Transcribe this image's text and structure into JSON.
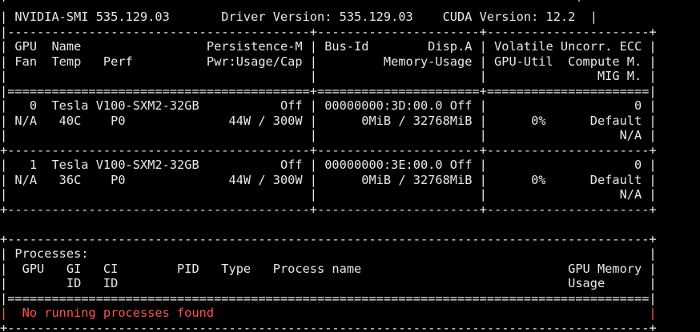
{
  "theme": {
    "background": "#000000",
    "foreground": "#e8e8e8",
    "error_text": "#ff5151"
  },
  "terminal": {
    "lines": [
      "+-----------------------------------------------------------------------------+",
      "| NVIDIA-SMI 535.129.03       Driver Version: 535.129.03    CUDA Version: 12.2  |",
      "|-----------------------------------------+----------------------+----------------------+",
      "| GPU  Name                 Persistence-M | Bus-Id        Disp.A | Volatile Uncorr. ECC |",
      "| Fan  Temp   Perf          Pwr:Usage/Cap |         Memory-Usage | GPU-Util  Compute M. |",
      "|                                         |                      |               MIG M. |",
      "|=========================================+======================+======================|",
      "|   0  Tesla V100-SXM2-32GB           Off | 00000000:3D:00.0 Off |                    0 |",
      "| N/A   40C    P0              44W / 300W |      0MiB / 32768MiB |      0%      Default |",
      "|                                         |                      |                  N/A |",
      "+-----------------------------------------+----------------------+----------------------+",
      "|   1  Tesla V100-SXM2-32GB           Off | 00000000:3E:00.0 Off |                    0 |",
      "| N/A   36C    P0              44W / 300W |      0MiB / 32768MiB |      0%      Default |",
      "|                                         |                      |                  N/A |",
      "+-----------------------------------------+----------------------+----------------------+",
      "",
      "+---------------------------------------------------------------------------------------+",
      "| Processes:                                                                            |",
      "|  GPU   GI   CI        PID   Type   Process name                            GPU Memory |",
      "|        ID   ID                                                             Usage      |",
      "|=======================================================================================|",
      "|  No running processes found                                                           |",
      "+---------------------------------------------------------------------------------------+"
    ]
  }
}
